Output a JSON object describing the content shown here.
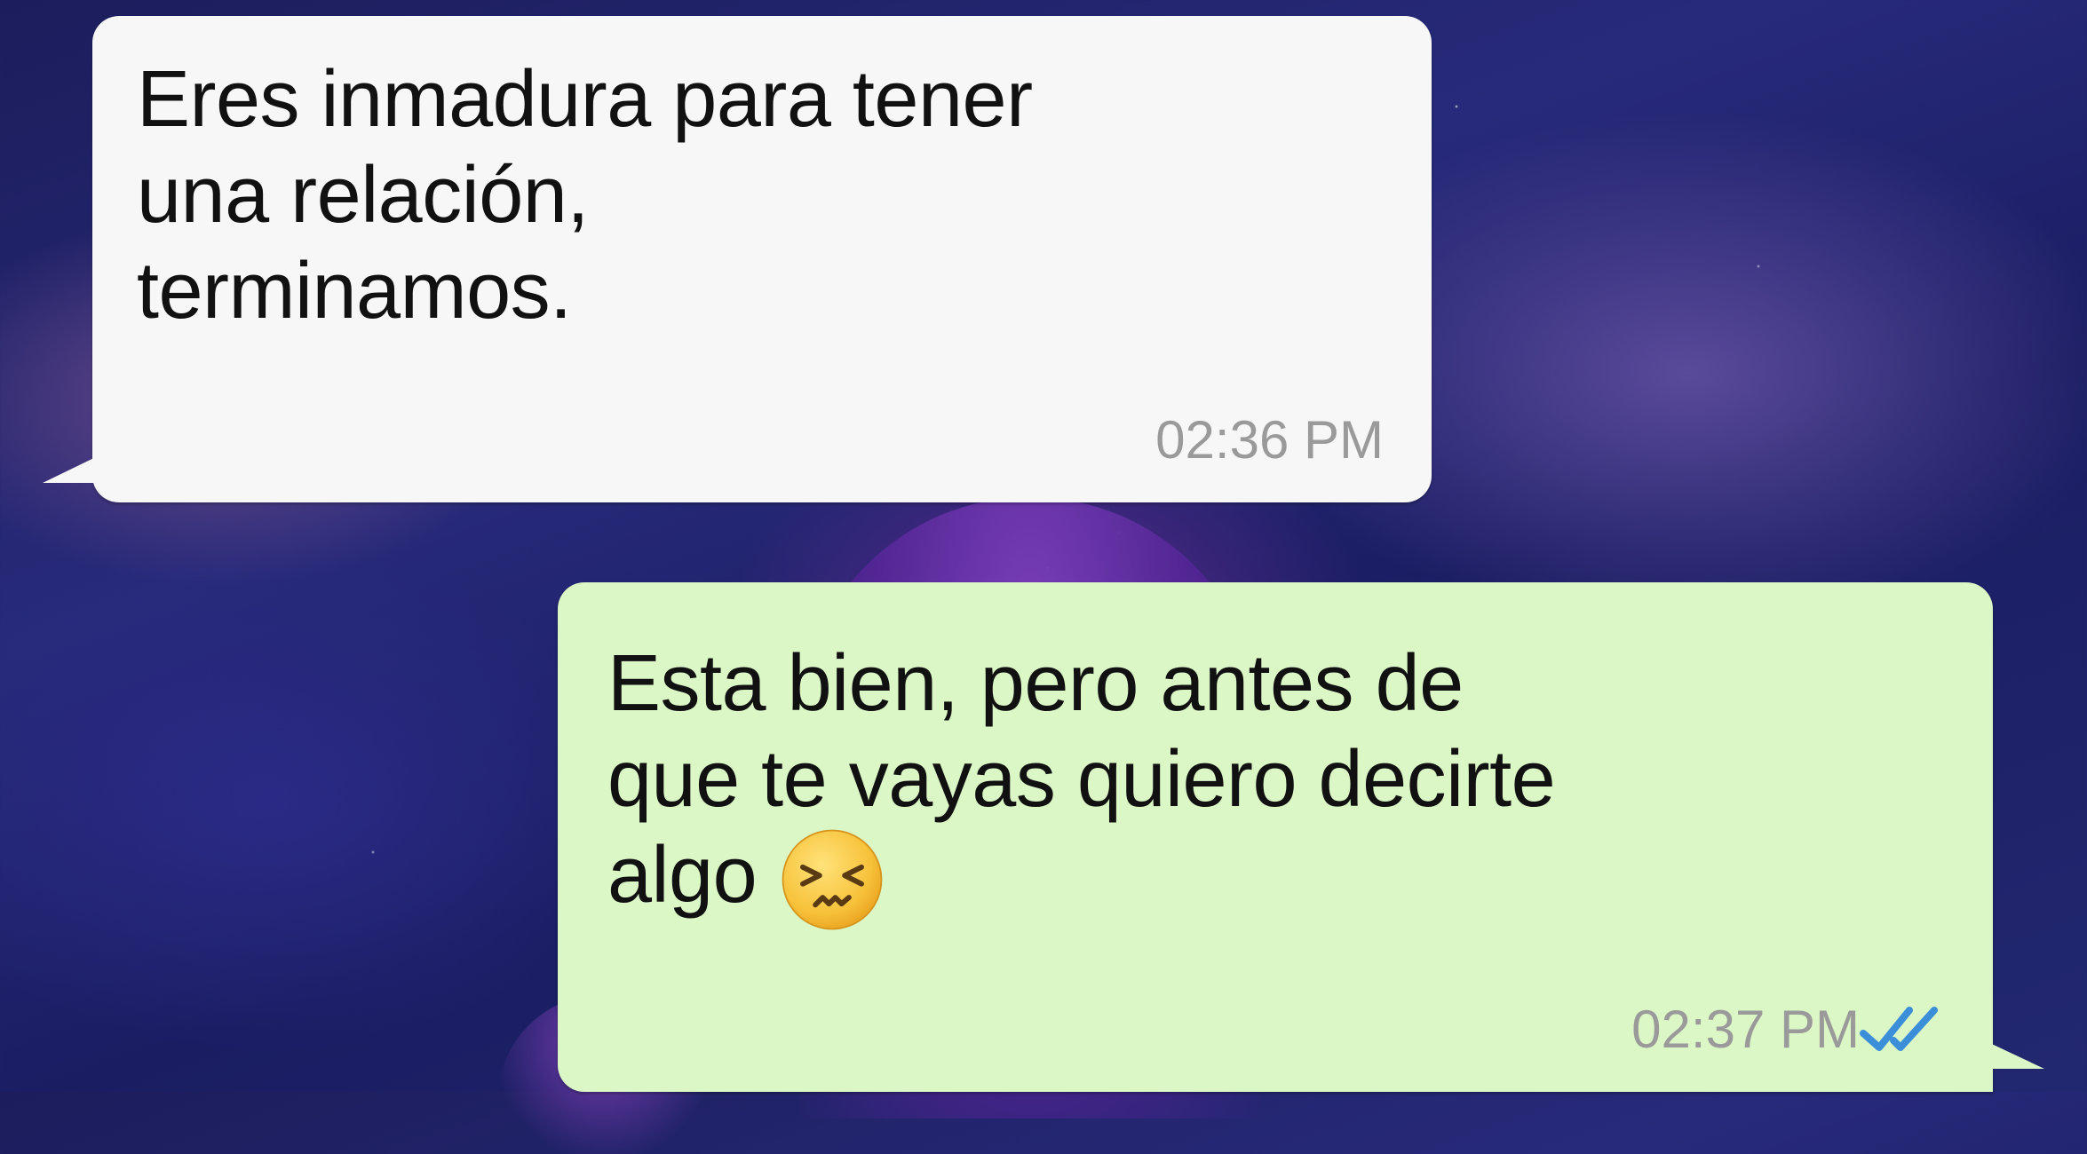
{
  "conversation": {
    "messages": [
      {
        "direction": "incoming",
        "text": "Eres inmadura para tener\nuna relación,\nterminamos.",
        "time": "02:36 PM"
      },
      {
        "direction": "outgoing",
        "text": "Esta bien, pero antes de\nque te vayas quiero decirte\nalgo",
        "emoji": "confounded-face-emoji",
        "time": "02:37 PM",
        "status_icon": "double-check-read-icon"
      }
    ]
  },
  "colors": {
    "incoming_bubble": "#f7f7f7",
    "outgoing_bubble": "#dcf7c6",
    "timestamp": "#9a9a9a",
    "read_check": "#3b8fd9"
  }
}
